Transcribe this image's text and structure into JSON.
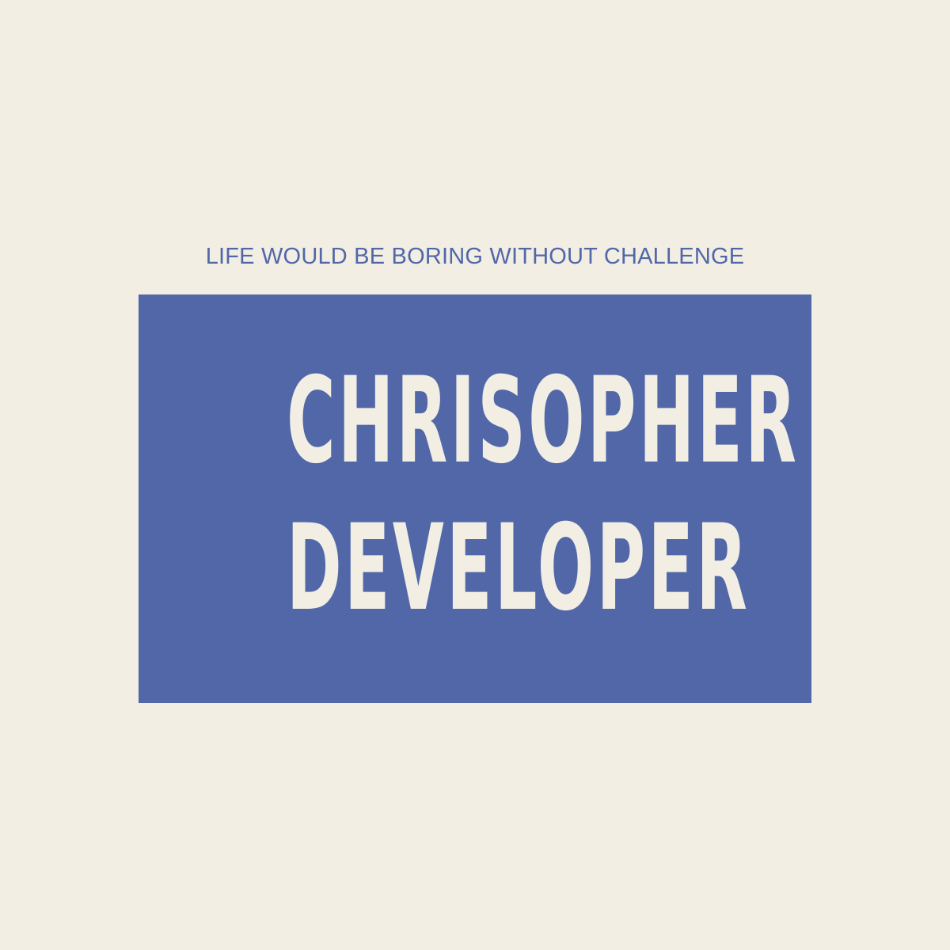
{
  "poster": {
    "tagline": "LIFE WOULD BE BORING WITHOUT CHALLENGE",
    "headline_line_1": "CHRISOPHER",
    "headline_line_2": "DEVELOPER"
  },
  "colors": {
    "background": "#f2eee4",
    "accent": "#5167a8"
  }
}
